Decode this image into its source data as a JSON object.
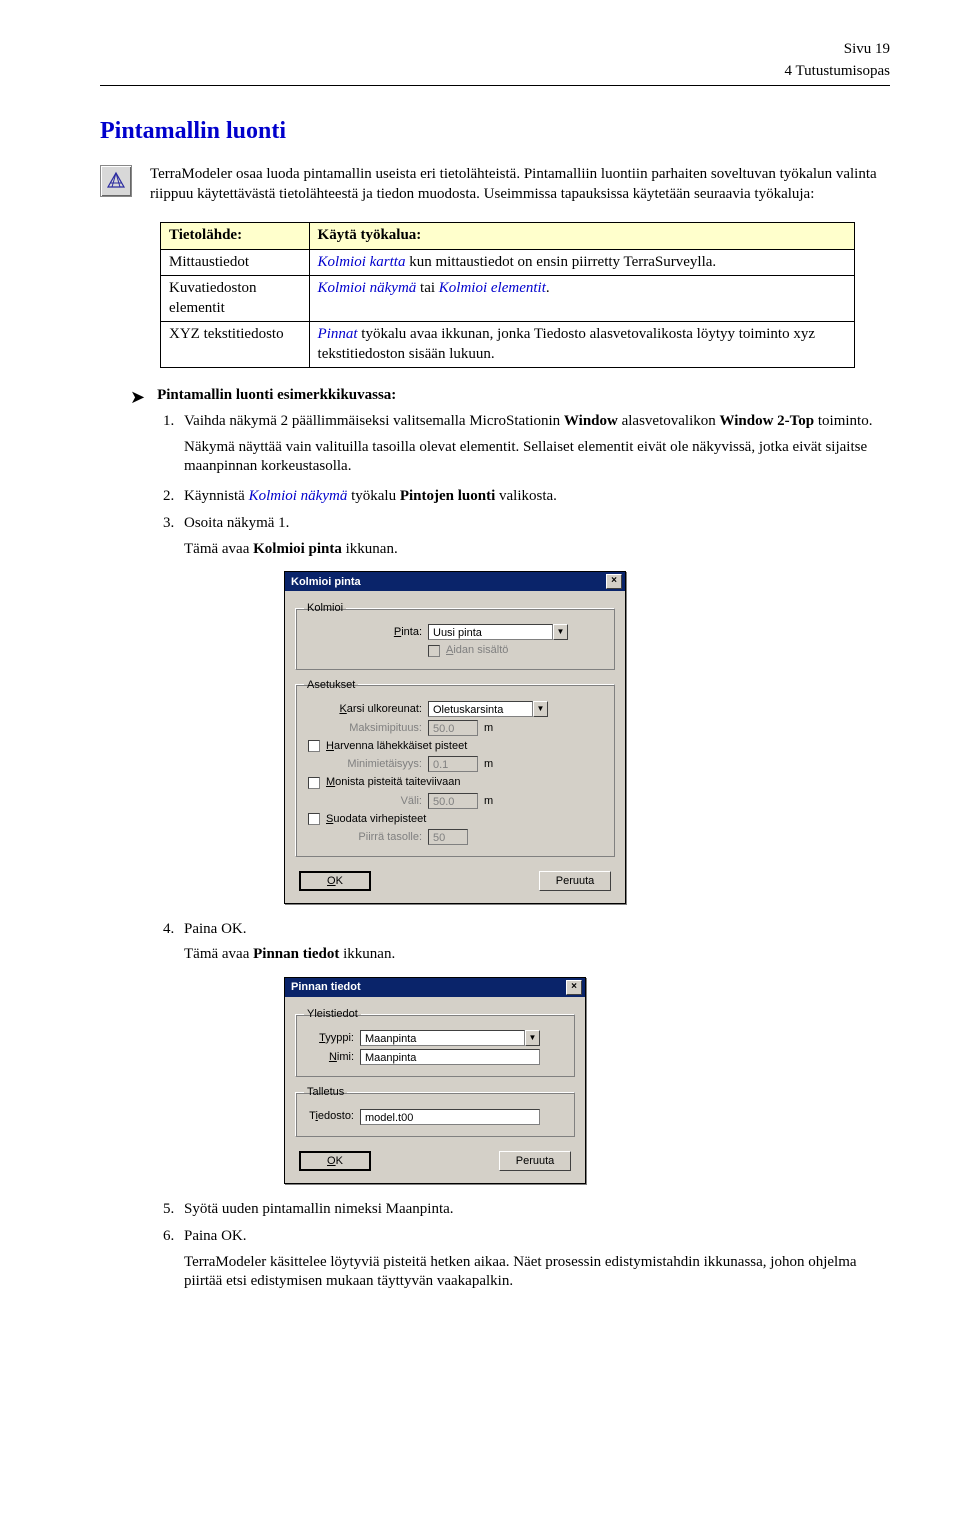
{
  "page": {
    "number_label": "Sivu 19",
    "chapter_label": "4 Tutustumisopas"
  },
  "section": {
    "title": "Pintamallin luonti",
    "intro": "TerraModeler osaa luoda pintamallin useista eri tietolähteistä. Pintamalliin luontiin parhaiten soveltuvan työkalun valinta riippuu käytettävästä tietolähteestä ja tiedon muodosta. Useimmissa tapauksissa käytetään seuraavia työkaluja:"
  },
  "table": {
    "headers": {
      "col1": "Tietolähde:",
      "col2": "Käytä työkalua:"
    },
    "rows": [
      {
        "c1": "Mittaustiedot",
        "c2a": "Kolmioi kartta",
        "c2b": " kun mittaustiedot on ensin piirretty TerraSurveylla."
      },
      {
        "c1": "Kuvatiedoston elementit",
        "c2a": "Kolmioi näkymä",
        "c2b": " tai ",
        "c2c": "Kolmioi elementit",
        "c2d": "."
      },
      {
        "c1": "XYZ tekstitiedosto",
        "c2a": "Pinnat",
        "c2b": " työkalu avaa ikkunan, jonka Tiedosto alasvetovalikosta löytyy toiminto xyz tekstitiedoston sisään lukuun."
      }
    ]
  },
  "example": {
    "heading": "Pintamallin luonti esimerkkikuvassa:",
    "step1a": "Vaihda näkymä 2 päällimmäiseksi valitsemalla MicroStationin ",
    "step1b": "Window",
    "step1c": " alasvetovalikon ",
    "step1d": "Window 2-Top",
    "step1e": " toiminto.",
    "step1_note": "Näkymä näyttää vain valituilla tasoilla olevat elementit. Sellaiset elementit eivät ole näkyvissä, jotka eivät sijaitse maanpinnan korkeustasolla.",
    "step2a": "Käynnistä ",
    "step2b": "Kolmioi näkymä",
    "step2c": " työkalu ",
    "step2d": "Pintojen luonti",
    "step2e": " valikosta.",
    "step3": "Osoita näkymä 1.",
    "step3_note_a": "Tämä avaa ",
    "step3_note_b": "Kolmioi pinta",
    "step3_note_c": " ikkunan.",
    "step4": "Paina OK.",
    "step4_note_a": "Tämä avaa ",
    "step4_note_b": "Pinnan tiedot",
    "step4_note_c": " ikkunan.",
    "step5": "Syötä uuden pintamallin nimeksi Maanpinta.",
    "step6": "Paina OK.",
    "footer": "TerraModeler käsittelee löytyviä pisteitä hetken aikaa. Näet prosessin edistymistahdin ikkunassa, johon ohjelma piirtää etsi edistymisen mukaan täyttyvän vaakapalkin."
  },
  "dialog1": {
    "title": "Kolmioi pinta",
    "group1": "Kolmioi",
    "pinta_label": "Pinta:",
    "pinta_value": "Uusi pinta",
    "aidan_label": "Aidan sisältö",
    "group2": "Asetukset",
    "karsi_label": "Karsi ulkoreunat:",
    "karsi_value": "Oletuskarsinta",
    "maksimi_label": "Maksimipituus:",
    "maksimi_value": "50.0",
    "unit_m": "m",
    "harvenna_label": "Harvenna lähekkäiset pisteet",
    "mini_label": "Minimietäisyys:",
    "mini_value": "0.1",
    "monista_label": "Monista pisteitä taiteviivaan",
    "vali_label": "Väli:",
    "vali_value": "50.0",
    "suodata_label": "Suodata virhepisteet",
    "piirra_label": "Piirrä tasolle:",
    "piirra_value": "50",
    "ok": "OK",
    "cancel": "Peruuta"
  },
  "dialog2": {
    "title": "Pinnan tiedot",
    "group1": "Yleistiedot",
    "tyyppi_label": "Tyyppi:",
    "tyyppi_value": "Maanpinta",
    "nimi_label": "Nimi:",
    "nimi_value": "Maanpinta",
    "group2": "Talletus",
    "tiedosto_label": "Tiedosto:",
    "tiedosto_value": "model.t00",
    "ok": "OK",
    "cancel": "Peruuta"
  }
}
